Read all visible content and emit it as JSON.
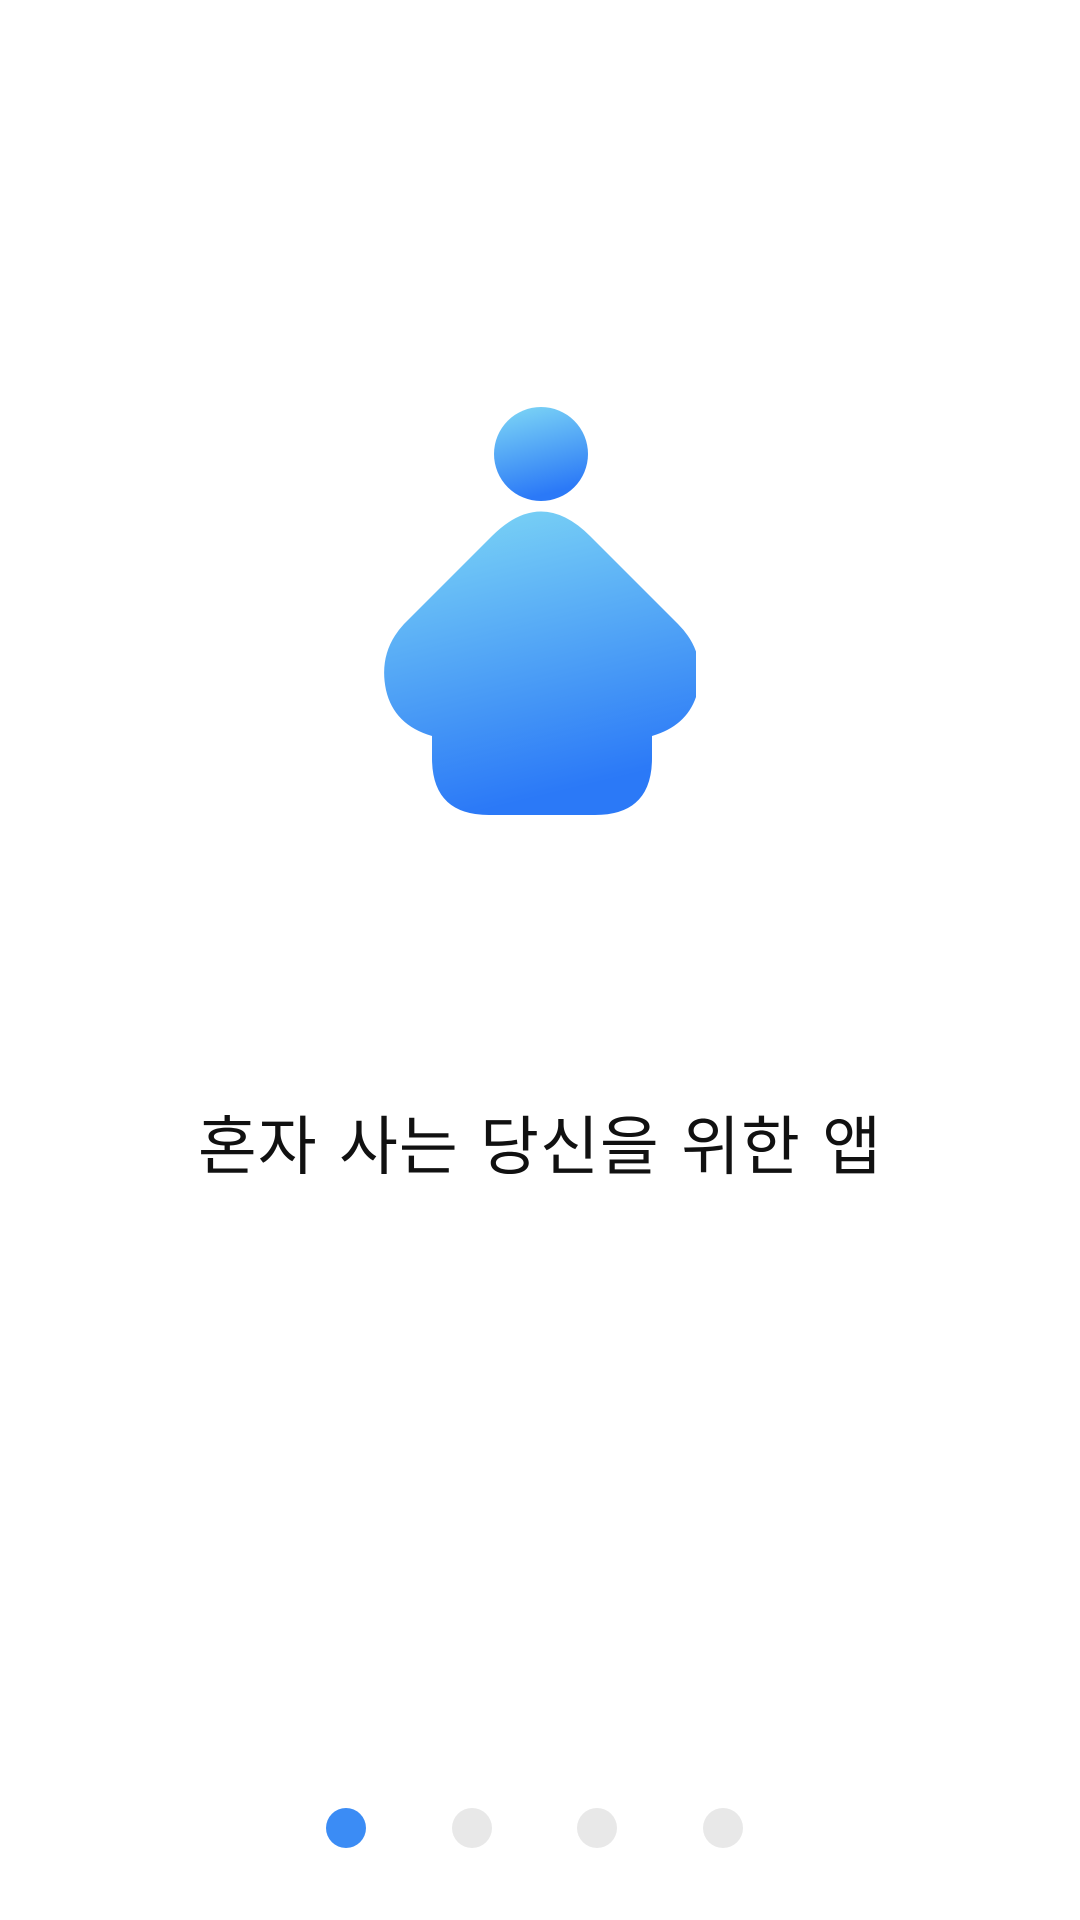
{
  "onboarding": {
    "headline": "혼자 사는 당신을 위한 앱",
    "logo_icon": "house-person-icon",
    "colors": {
      "gradient_top": "#7fd8f5",
      "gradient_bottom": "#2b79f7",
      "dot_active": "#3b8cf5",
      "dot_inactive": "#e8e8e8"
    },
    "pager": {
      "total_pages": 4,
      "current_page": 1
    }
  }
}
